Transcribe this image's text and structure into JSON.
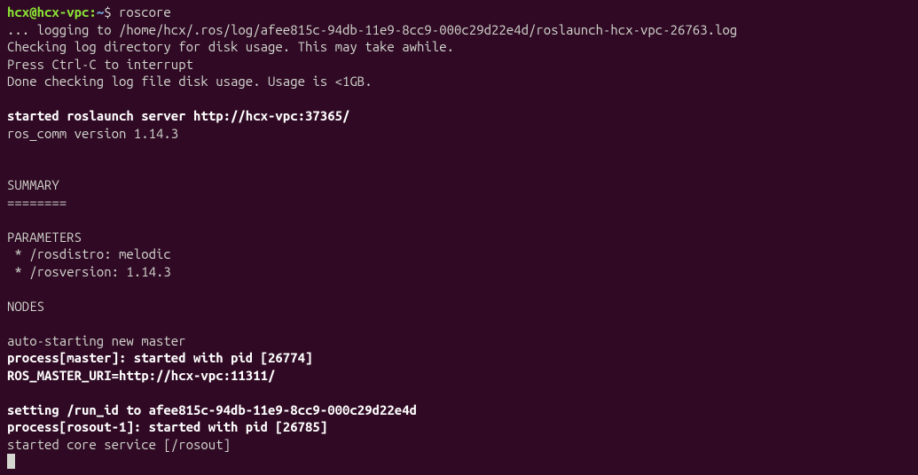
{
  "prompt": {
    "user_host": "hcx@hcx-vpc",
    "separator": ":",
    "path": "~",
    "dollar": "$ "
  },
  "command": "roscore",
  "lines": [
    {
      "text": "... logging to /home/hcx/.ros/log/afee815c-94db-11e9-8cc9-000c29d22e4d/roslaunch-hcx-vpc-26763.log",
      "bold": false
    },
    {
      "text": "Checking log directory for disk usage. This may take awhile.",
      "bold": false
    },
    {
      "text": "Press Ctrl-C to interrupt",
      "bold": false
    },
    {
      "text": "Done checking log file disk usage. Usage is <1GB.",
      "bold": false
    },
    {
      "text": "",
      "bold": false
    },
    {
      "text": "started roslaunch server http://hcx-vpc:37365/",
      "bold": true
    },
    {
      "text": "ros_comm version 1.14.3",
      "bold": false
    },
    {
      "text": "",
      "bold": false
    },
    {
      "text": "",
      "bold": false
    },
    {
      "text": "SUMMARY",
      "bold": false
    },
    {
      "text": "========",
      "bold": false
    },
    {
      "text": "",
      "bold": false
    },
    {
      "text": "PARAMETERS",
      "bold": false
    },
    {
      "text": " * /rosdistro: melodic",
      "bold": false
    },
    {
      "text": " * /rosversion: 1.14.3",
      "bold": false
    },
    {
      "text": "",
      "bold": false
    },
    {
      "text": "NODES",
      "bold": false
    },
    {
      "text": "",
      "bold": false
    },
    {
      "text": "auto-starting new master",
      "bold": false
    },
    {
      "text": "process[master]: started with pid [26774]",
      "bold": true
    },
    {
      "text": "ROS_MASTER_URI=http://hcx-vpc:11311/",
      "bold": true
    },
    {
      "text": "",
      "bold": false
    },
    {
      "text": "setting /run_id to afee815c-94db-11e9-8cc9-000c29d22e4d",
      "bold": true
    },
    {
      "text": "process[rosout-1]: started with pid [26785]",
      "bold": true
    },
    {
      "text": "started core service [/rosout]",
      "bold": false
    }
  ]
}
